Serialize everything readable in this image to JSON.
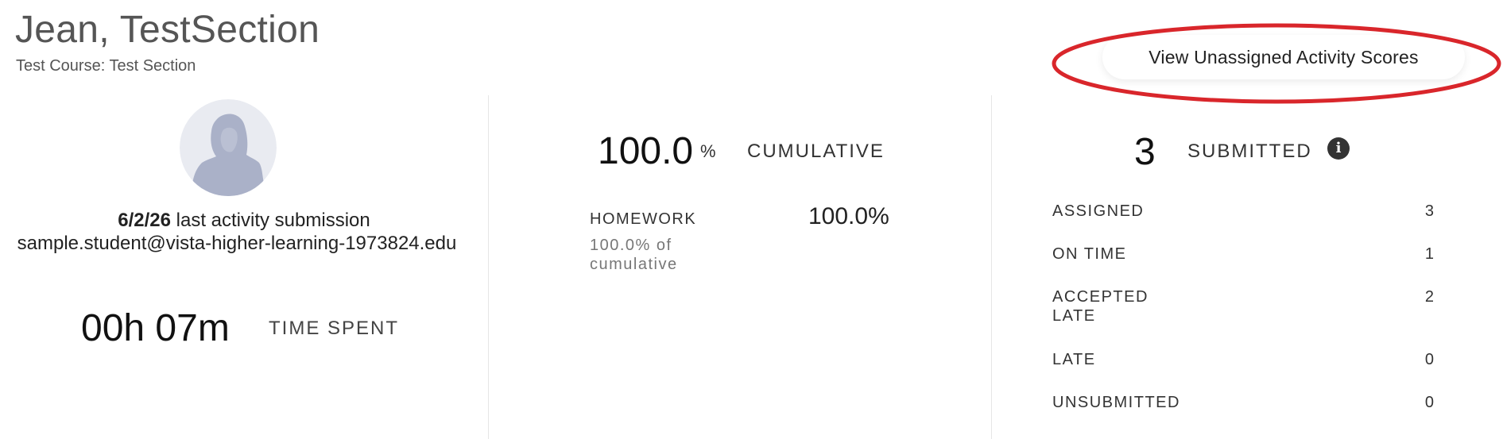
{
  "header": {
    "student_name": "Jean, TestSection",
    "course": "Test Course: Test Section",
    "view_unassigned_button": "View Unassigned Activity Scores"
  },
  "profile": {
    "avatar_icon": "student-silhouette-icon",
    "last_activity_date": "6/2/26",
    "last_activity_text": " last activity submission",
    "email": "sample.student@vista-higher-learning-1973824.edu",
    "time_spent_value": "00h 07m",
    "time_spent_label": "TIME SPENT"
  },
  "cumulative": {
    "value": "100.0",
    "percent_sign": "%",
    "label": "CUMULATIVE",
    "categories": [
      {
        "label": "HOMEWORK",
        "value": "100.0%",
        "sub": "100.0% of cumulative"
      }
    ]
  },
  "submissions": {
    "count": "3",
    "label": "SUBMITTED",
    "info_icon": "info-icon",
    "rows": [
      {
        "label": "ASSIGNED",
        "value": "3"
      },
      {
        "label": "ON TIME",
        "value": "1"
      },
      {
        "label": "ACCEPTED LATE",
        "value": "2"
      },
      {
        "label": "LATE",
        "value": "0"
      },
      {
        "label": "UNSUBMITTED",
        "value": "0"
      }
    ]
  },
  "colors": {
    "annotation": "#d9262b",
    "avatar_bg": "#e9ebf1",
    "avatar_figure": "#aab1c8",
    "divider": "#e6e6e6"
  }
}
